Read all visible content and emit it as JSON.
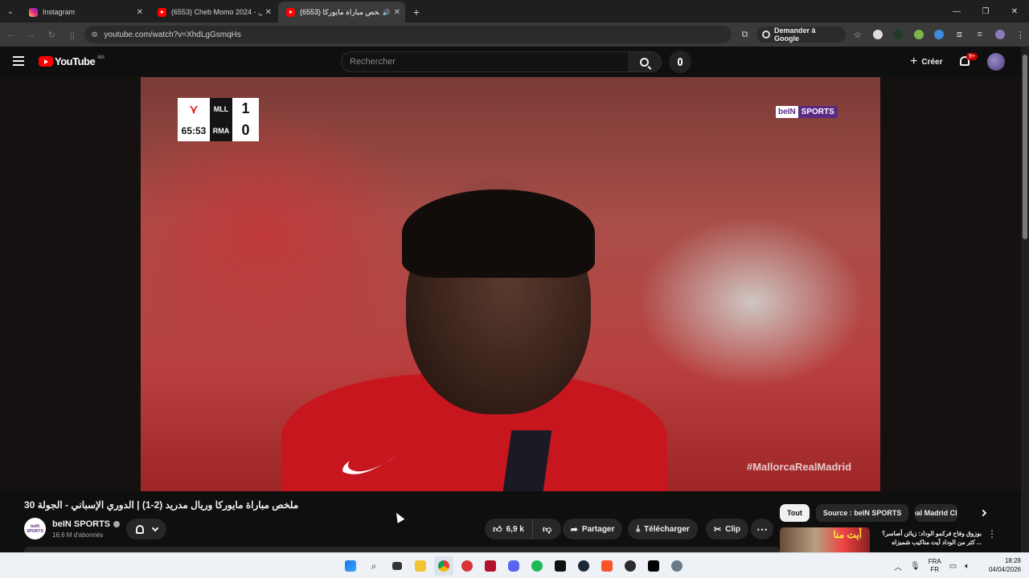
{
  "browser": {
    "tabs": [
      {
        "title": "Instagram",
        "favicon": "instagram-icon",
        "active": false
      },
      {
        "title": "(6553) Cheb Momo 2024 - يول",
        "favicon": "youtube-icon",
        "active": false
      },
      {
        "title": "(6553) ملخص مباراة مايوركا",
        "favicon": "youtube-icon",
        "active": true
      }
    ],
    "url": "youtube.com/watch?v=XhdLgGsmqHs",
    "ask_google_label": "Demander à Google"
  },
  "youtube": {
    "logo_text": "YouTube",
    "country_code": "MA",
    "search_placeholder": "Rechercher",
    "create_label": "Créer",
    "notification_badge": "9+"
  },
  "video": {
    "scorebug": {
      "clock": "65:53",
      "home_team": "MLL",
      "away_team": "RMA",
      "home_score": "1",
      "away_score": "0"
    },
    "broadcaster_logo": {
      "part1": "beIN",
      "part2": "SPORTS"
    },
    "hashtag": "#MallorcaRealMadrid",
    "title": "ملخص مباراة مايوركا وريال مدريد (2-1) | الدوري الإسباني - الجولة 30"
  },
  "channel": {
    "name": "beIN SPORTS",
    "subscribers": "16,6 M d'abonnés",
    "logo_text": "beIN SPORTS"
  },
  "actions": {
    "likes": "6,9 k",
    "share_label": "Partager",
    "download_label": "Télécharger",
    "clip_label": "Clip"
  },
  "chips": [
    "Tout",
    "Source : beIN SPORTS",
    "Real Madrid Club"
  ],
  "recommendation": {
    "thumb_text": "أيت منا",
    "title": "بوزوق وفاح فركمو الوداد: زيائن أصاسر؟ ... كثر من الوداد آيت مناكيب شميزاه"
  },
  "taskbar": {
    "language": {
      "line1": "FRA",
      "line2": "FR"
    },
    "time": "18:28",
    "date": "04/04/2026"
  },
  "colors": {
    "youtube_red": "#ff0000",
    "bein_purple": "#5a2a82",
    "background": "#0f0f0f"
  }
}
